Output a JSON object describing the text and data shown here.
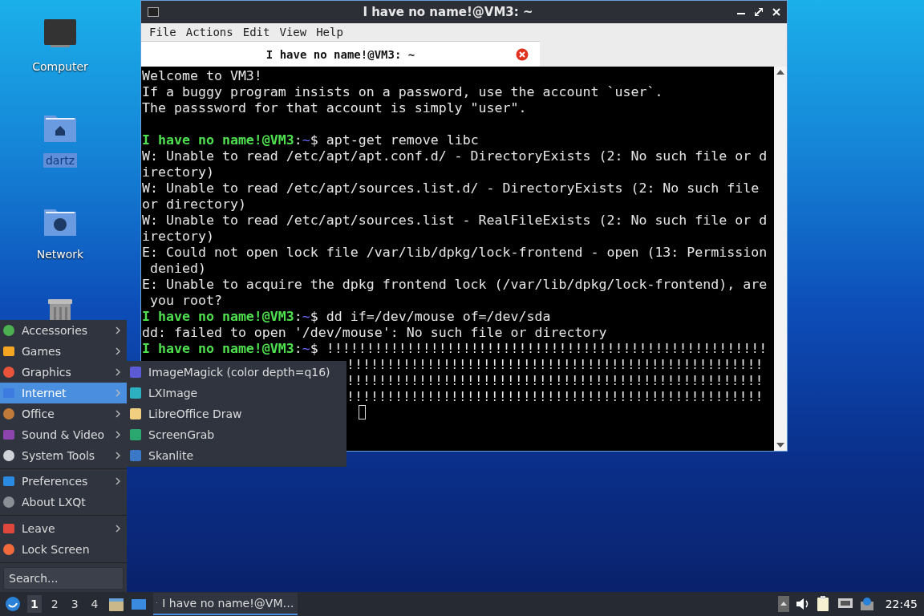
{
  "desktop_icons": [
    {
      "label": "Computer",
      "selected": false
    },
    {
      "label": "dartz",
      "selected": true
    },
    {
      "label": "Network",
      "selected": false
    },
    {
      "kind": "trash"
    }
  ],
  "terminal": {
    "title": "I have no name!@VM3: ~",
    "menu": [
      "File",
      "Actions",
      "Edit",
      "View",
      "Help"
    ],
    "tabs": [
      {
        "label": "I have no name!@VM3: ~",
        "selected": true
      }
    ],
    "lines": [
      {
        "kind": "text",
        "text": "Welcome to VM3!"
      },
      {
        "kind": "text",
        "text": "If a buggy program insists on a password, use the account `user`."
      },
      {
        "kind": "text",
        "text": "The passsword for that account is simply \"user\"."
      },
      {
        "kind": "blank"
      },
      {
        "kind": "prompt",
        "user": "I have no name!@VM3",
        "sep": ":",
        "path": "~",
        "command": "$ apt-get remove libc"
      },
      {
        "kind": "text",
        "text": "W: Unable to read /etc/apt/apt.conf.d/ - DirectoryExists (2: No such file or d"
      },
      {
        "kind": "text",
        "text": "irectory)"
      },
      {
        "kind": "text",
        "text": "W: Unable to read /etc/apt/sources.list.d/ - DirectoryExists (2: No such file"
      },
      {
        "kind": "text",
        "text": "or directory)"
      },
      {
        "kind": "text",
        "text": "W: Unable to read /etc/apt/sources.list - RealFileExists (2: No such file or d"
      },
      {
        "kind": "text",
        "text": "irectory)"
      },
      {
        "kind": "text",
        "text": "E: Could not open lock file /var/lib/dpkg/lock-frontend - open (13: Permission"
      },
      {
        "kind": "text",
        "text": " denied)"
      },
      {
        "kind": "text",
        "text": "E: Unable to acquire the dpkg frontend lock (/var/lib/dpkg/lock-frontend), are"
      },
      {
        "kind": "text",
        "text": " you root?"
      },
      {
        "kind": "prompt",
        "user": "I have no name!@VM3",
        "sep": ":",
        "path": "~",
        "command": "$ dd if=/dev/mouse of=/dev/sda"
      },
      {
        "kind": "text",
        "text": "dd: failed to open '/dev/mouse': No such file or directory"
      },
      {
        "kind": "prompt",
        "user": "I have no name!@VM3",
        "sep": ":",
        "path": "~",
        "command": "$ !!!!!!!!!!!!!!!!!!!!!!!!!!!!!!!!!!!!!!!!!!!!!!!!!!!!!!!"
      },
      {
        "kind": "partial",
        "text": "!!!!!!!!!!!!!!!!!!!!!!!!!!!!!!!!!!!!!!!!!!!!!!!!!!!!"
      },
      {
        "kind": "partial",
        "text": "!!!!!!!!!!!!!!!!!!!!!!!!!!!!!!!!!!!!!!!!!!!!!!!!!!!!"
      },
      {
        "kind": "partial",
        "text": "!!!!!!!!!!!!!!!!!!!!!!!!!!!!!!!!!!!!!!!!!!!!!!!!!!!!"
      },
      {
        "kind": "cursor"
      }
    ]
  },
  "menu": {
    "sections": [
      [
        {
          "label": "Accessories",
          "submenu": true,
          "selected": false
        },
        {
          "label": "Games",
          "submenu": true,
          "selected": false
        },
        {
          "label": "Graphics",
          "submenu": true,
          "selected": false
        },
        {
          "label": "Internet",
          "submenu": true,
          "selected": true
        },
        {
          "label": "Office",
          "submenu": true,
          "selected": false
        },
        {
          "label": "Sound & Video",
          "submenu": true,
          "selected": false
        },
        {
          "label": "System Tools",
          "submenu": true,
          "selected": false
        }
      ],
      [
        {
          "label": "Preferences",
          "submenu": true,
          "selected": false
        },
        {
          "label": "About LXQt",
          "submenu": false,
          "selected": false
        }
      ],
      [
        {
          "label": "Leave",
          "submenu": true,
          "selected": false
        },
        {
          "label": "Lock Screen",
          "submenu": false,
          "selected": false
        }
      ]
    ],
    "search": {
      "placeholder": "Search..."
    }
  },
  "submenu": [
    {
      "label": "ImageMagick (color depth=q16)"
    },
    {
      "label": "LXImage"
    },
    {
      "label": "LibreOffice Draw"
    },
    {
      "label": "ScreenGrab"
    },
    {
      "label": "Skanlite"
    }
  ],
  "taskbar": {
    "desktops": [
      {
        "label": "1",
        "selected": true
      },
      {
        "label": "2",
        "selected": false
      },
      {
        "label": "3",
        "selected": false
      },
      {
        "label": "4",
        "selected": false
      }
    ],
    "tasks": [
      {
        "label": "I have no name!@VM…",
        "selected": true
      }
    ],
    "clock": "22:45"
  }
}
